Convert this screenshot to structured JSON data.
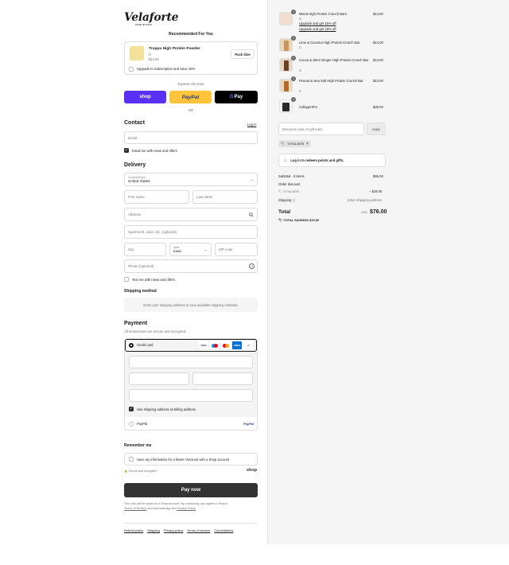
{
  "brand": {
    "name": "Velaforte",
    "tagline": "ATHLETICS"
  },
  "recommend": {
    "heading": "Recommended For You",
    "product": {
      "name": "Troppo High Protein Powder",
      "variant": "S",
      "price": "$14.00",
      "button": "Pack Size",
      "subscribe": "Upgrade to Subscription and Save 15%"
    }
  },
  "express": {
    "label": "Express checkout",
    "shop": "shop",
    "paypal": "PayPal",
    "gpay": "Pay",
    "or": "OR"
  },
  "contact": {
    "heading": "Contact",
    "login": "Log in",
    "email_placeholder": "Email",
    "news": "Email me with news and offers"
  },
  "delivery": {
    "heading": "Delivery",
    "country_label": "Country/Region",
    "country": "United States",
    "first": "First name",
    "last": "Last name",
    "address": "Address",
    "apt": "Apartment, suite, etc. (optional)",
    "city": "City",
    "state_label": "State",
    "state": "Iowa",
    "zip": "ZIP code",
    "phone": "Phone (optional)",
    "text": "Text me with news and offers"
  },
  "shipping": {
    "heading": "Shipping method",
    "note": "Enter your shipping address to view available shipping methods."
  },
  "payment": {
    "heading": "Payment",
    "sub": "All transactions are secure and encrypted.",
    "credit": "Credit card",
    "cards": [
      "VISA",
      "MC",
      "AMEX",
      "+4"
    ],
    "billing": "Use shipping address as billing address",
    "paypal": "PayPal",
    "paypal_logo": "PayPal"
  },
  "remember": {
    "heading": "Remember me",
    "save": "Save my information for a faster checkout with a Shop account",
    "secure": "Secure and encrypted",
    "shop_logo": "shop"
  },
  "pay": {
    "button": "Pay now",
    "legal1": "Your info will be saved to a Shop account. By continuing, you agree to Shop's",
    "terms": "Terms of Service",
    "legal2": "and acknowledge the",
    "privacy": "Privacy Policy"
  },
  "footer": [
    "Refund policy",
    "Shipping",
    "Privacy policy",
    "Terms of service",
    "Cancellations"
  ],
  "cart": {
    "items": [
      {
        "qty": "1",
        "name": "Mixed High Protein Crunch Bars",
        "variant": "S",
        "price": "$14.00",
        "upgrade1": "Upgrade and get 15% off",
        "upgrade2": "Upgrade and get 15% off"
      },
      {
        "qty": "1",
        "name": "Lime & Coconut High Protein Crunch Bar",
        "variant": "S",
        "price": "$14.00"
      },
      {
        "qty": "1",
        "name": "Cocoa & Stem Ginger High Protein Crunch Bar",
        "variant": "S",
        "price": "$14.00"
      },
      {
        "qty": "1",
        "name": "Peanut & Sea Salt High Protein Crunch Bar",
        "variant": "S",
        "price": "$14.00"
      },
      {
        "qty": "1",
        "name": "CollagenPro",
        "price": "$39.00"
      }
    ],
    "discount_placeholder": "Discount code or gift card",
    "apply": "Apply",
    "code": "TOTALMTB",
    "remove": "×",
    "login_points": "Log in to redeem points and gifts.",
    "subtotal_label": "Subtotal · 5 items",
    "subtotal": "$95.00",
    "order_discount": "Order discount",
    "discount_code": "TOTALMTB",
    "discount_value": "– $19.00",
    "shipping_label": "Shipping",
    "shipping_value": "Enter shipping address",
    "total_label": "Total",
    "currency": "USD",
    "total": "$76.00",
    "savings_label": "TOTAL SAVINGS",
    "savings": "$19.00"
  }
}
